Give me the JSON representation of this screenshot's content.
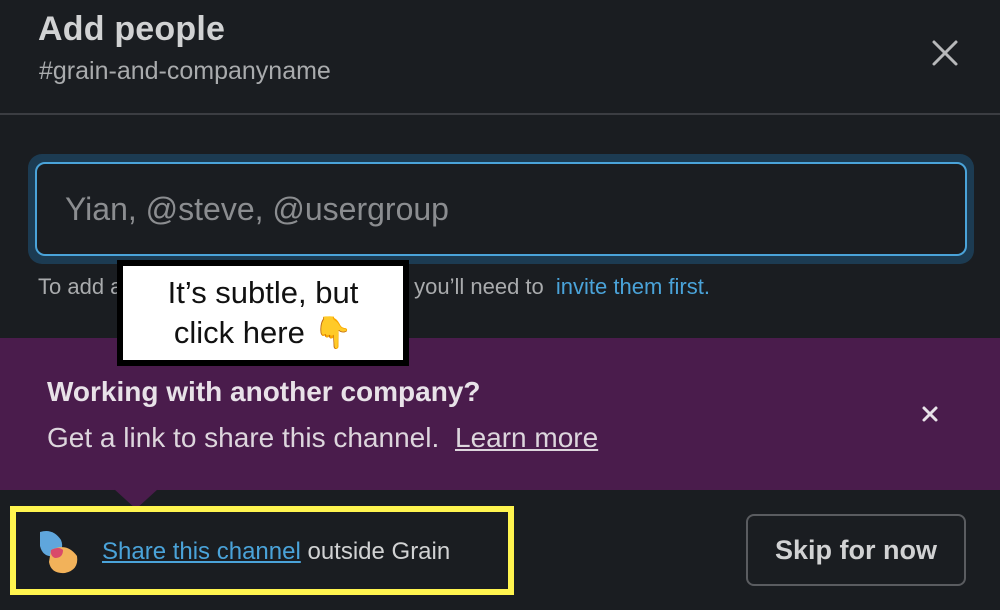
{
  "modal": {
    "title": "Add people",
    "subtitle": "#grain-and-companyname",
    "close_icon": "close-icon"
  },
  "input": {
    "placeholder": "Yian, @steve, @usergroup",
    "value": ""
  },
  "hint": {
    "text_start": "To add a",
    "text_end": "ack, you’ll need to",
    "link": "invite them first."
  },
  "callout": {
    "line1": "It’s subtle, but",
    "line2": "click here",
    "emoji": "👇"
  },
  "banner": {
    "heading": "Working with another company?",
    "text": "Get a link to share this channel.",
    "link": "Learn more",
    "close_icon": "close-icon",
    "background": "#4a1c4c"
  },
  "footer": {
    "share_link": "Share this channel",
    "share_rest": " outside Grain",
    "skip_label": "Skip for now",
    "logo_icon": "grain-logo-icon",
    "highlight_color": "#fff44f"
  },
  "colors": {
    "background": "#1a1d21",
    "link": "#4aa3d9",
    "text": "#d1d2d3"
  }
}
